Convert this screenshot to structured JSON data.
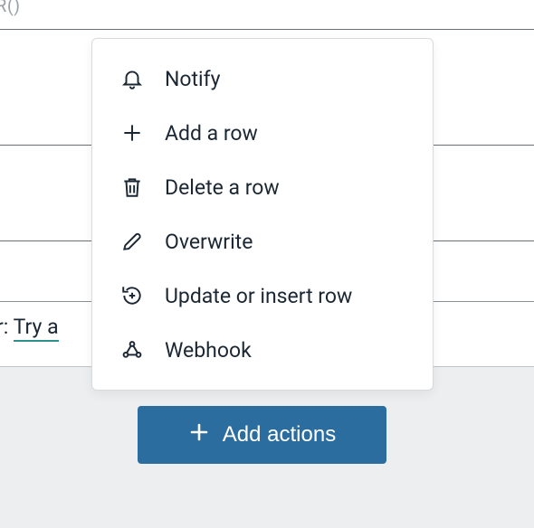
{
  "partial_top": "R()",
  "partial_mid_prefix": "r: ",
  "partial_mid_link": "Try a ",
  "menu": {
    "items": [
      {
        "label": "Notify"
      },
      {
        "label": "Add a row"
      },
      {
        "label": "Delete a row"
      },
      {
        "label": "Overwrite"
      },
      {
        "label": "Update or insert row"
      },
      {
        "label": "Webhook"
      }
    ]
  },
  "add_actions_label": "Add actions"
}
